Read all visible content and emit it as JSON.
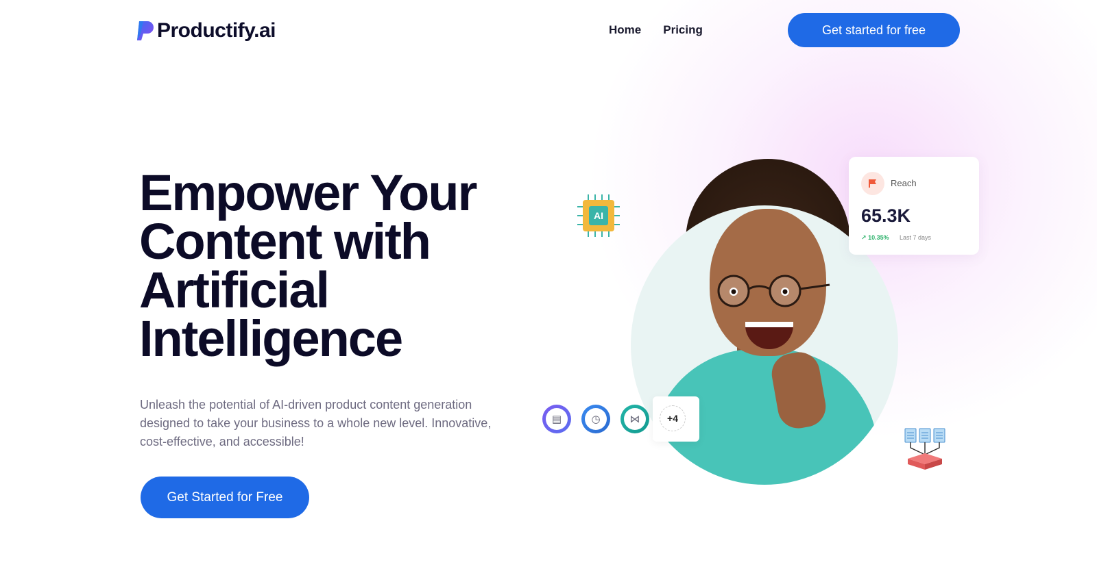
{
  "brand": {
    "name": "Productify.ai",
    "accent": "#1f6ae6"
  },
  "nav": {
    "links": [
      "Home",
      "Pricing"
    ],
    "cta_label": "Get started for free"
  },
  "hero": {
    "title_lines": [
      "Empower Your",
      "Content with",
      "Artificial",
      "Intelligence"
    ],
    "subtitle": "Unleash the potential of AI-driven product content generation designed to take your business to a whole new level. Innovative, cost-effective, and accessible!",
    "cta_label": "Get Started for Free"
  },
  "illustration": {
    "chip_label": "AI",
    "reach_card": {
      "icon": "flag-icon",
      "label": "Reach",
      "value": "65.3K",
      "change": "10.35%",
      "period": "Last 7 days"
    },
    "tools": {
      "icons": [
        "chat-icon",
        "clock-icon",
        "network-icon"
      ],
      "more_label": "+4"
    }
  }
}
